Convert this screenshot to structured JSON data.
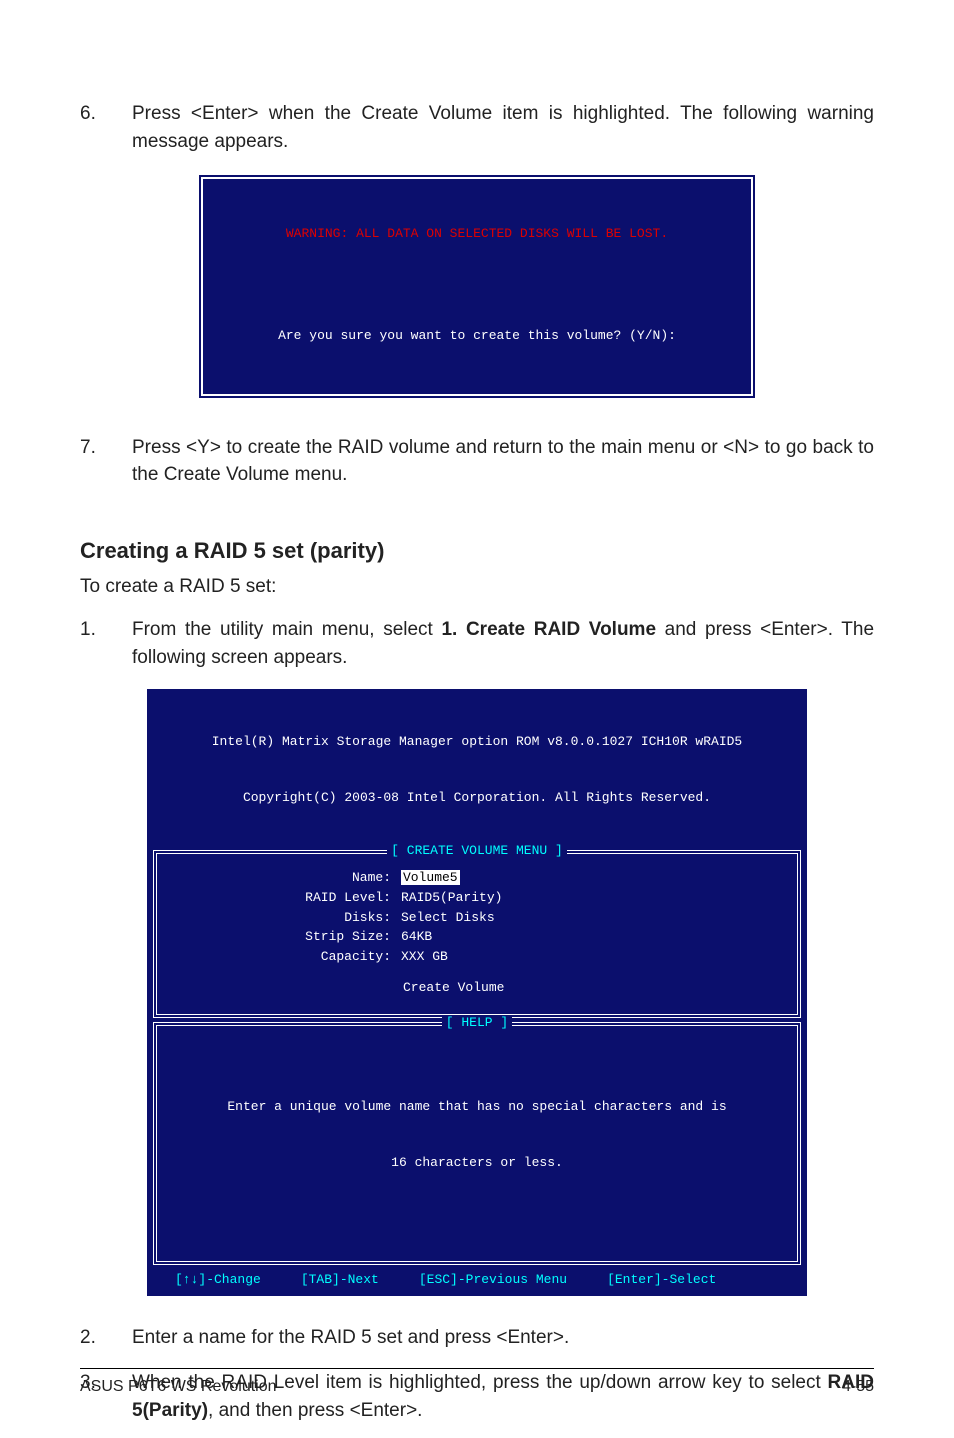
{
  "item6": {
    "num": "6.",
    "text": "Press <Enter> when the Create Volume item is highlighted. The following warning message appears."
  },
  "warn": {
    "red": "WARNING: ALL DATA ON SELECTED DISKS WILL BE LOST.",
    "white": "Are you sure you want to create this volume? (Y/N):"
  },
  "item7": {
    "num": "7.",
    "text": "Press <Y> to create the RAID volume and return to the main menu or <N> to go back to the Create Volume menu."
  },
  "section_title": "Creating a RAID 5 set (parity)",
  "section_lead": "To create a RAID 5 set:",
  "item1": {
    "num": "1.",
    "pre": "From the utility main menu, select ",
    "bold": "1. Create RAID Volume",
    "post": " and press <Enter>. The following screen appears."
  },
  "bios": {
    "hdr1": "Intel(R) Matrix Storage Manager option ROM v8.0.0.1027 ICH10R wRAID5",
    "hdr2": "Copyright(C) 2003-08 Intel Corporation. All Rights Reserved.",
    "frame1_title": "[ CREATE VOLUME MENU ]",
    "rows": [
      {
        "k": "Name:",
        "v": "Volume5",
        "hl": true
      },
      {
        "k": "RAID Level:",
        "v": "RAID5(Parity)"
      },
      {
        "k": "Disks:",
        "v": "Select Disks"
      },
      {
        "k": "Strip Size:",
        "v": "64KB"
      },
      {
        "k": "Capacity:",
        "v": "XXX   GB"
      }
    ],
    "create_volume": "Create Volume",
    "frame2_title": "[ HELP ]",
    "help1": "Enter a unique volume name that has no special characters and is",
    "help2": "16 characters or less.",
    "footer": {
      "a": "[↑↓]-Change",
      "b": "[TAB]-Next",
      "c": "[ESC]-Previous Menu",
      "d": "[Enter]-Select"
    }
  },
  "item2": {
    "num": "2.",
    "text": "Enter a name for the RAID 5 set and press <Enter>."
  },
  "item3": {
    "num": "3.",
    "pre": "When the RAID Level item is highlighted, press the up/down arrow key to select ",
    "bold": "RAID 5(Parity)",
    "post": ", and then press <Enter>."
  },
  "footer": {
    "left": "ASUS P6T6 WS Revolution",
    "right": "4-55"
  }
}
